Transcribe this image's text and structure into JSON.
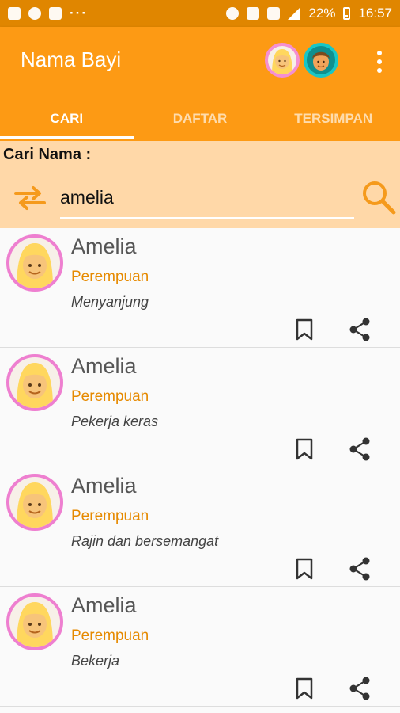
{
  "status_bar": {
    "battery": "22%",
    "time": "16:57",
    "overflow": "···"
  },
  "app_bar": {
    "title": "Nama Bayi",
    "tabs": [
      {
        "label": "CARI",
        "selected": true
      },
      {
        "label": "DAFTAR",
        "selected": false
      },
      {
        "label": "TERSIMPAN",
        "selected": false
      }
    ]
  },
  "search": {
    "label": "Cari Nama :",
    "value": "amelia"
  },
  "results": [
    {
      "name": "Amelia",
      "gender": "Perempuan",
      "meaning": "Menyanjung"
    },
    {
      "name": "Amelia",
      "gender": "Perempuan",
      "meaning": "Pekerja keras"
    },
    {
      "name": "Amelia",
      "gender": "Perempuan",
      "meaning": "Rajin dan bersemangat"
    },
    {
      "name": "Amelia",
      "gender": "Perempuan",
      "meaning": "Bekerja"
    }
  ],
  "colors": {
    "status_bar": "#e08600",
    "app_bar": "#fd9a14",
    "search_panel": "#ffd8a8",
    "gender_text": "#e68a00",
    "girl_ring": "#ee7fd0",
    "boy_ring": "#19c6c6"
  },
  "icons": [
    "swap-icon",
    "search-icon",
    "bookmark-icon",
    "share-icon",
    "overflow-menu-icon",
    "girl-avatar-icon",
    "boy-avatar-icon"
  ]
}
